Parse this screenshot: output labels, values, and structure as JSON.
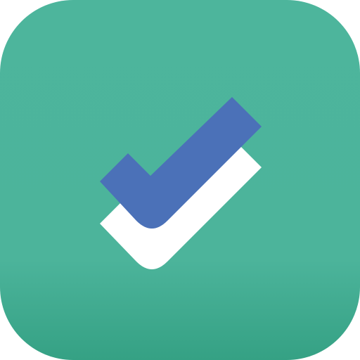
{
  "icon": {
    "name": "double-checkmark-icon",
    "colors": {
      "background_top": "#4db59c",
      "background_mid": "#4cb49b",
      "background_bottom": "#35a184",
      "checkmark_back": "#ffffff",
      "checkmark_front": "#4b71b8"
    }
  }
}
